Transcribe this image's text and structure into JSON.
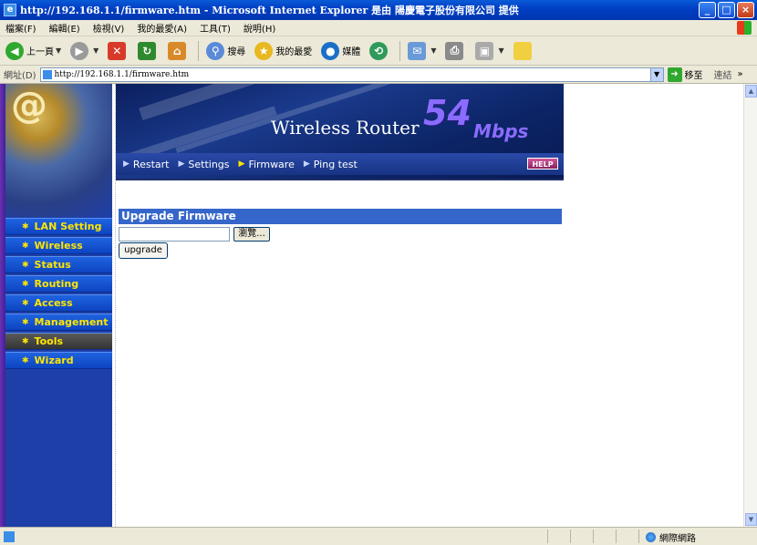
{
  "window": {
    "title": "http://192.168.1.1/firmware.htm - Microsoft Internet Explorer 是由 陽慶電子股份有限公司 提供",
    "controls": [
      "_",
      "□",
      "×"
    ]
  },
  "menubar": {
    "items": [
      "檔案(F)",
      "編輯(E)",
      "檢視(V)",
      "我的最愛(A)",
      "工具(T)",
      "說明(H)"
    ]
  },
  "toolbar": {
    "back_label": "上一頁",
    "search_label": "搜尋",
    "favorites_label": "我的最愛",
    "media_label": "媒體"
  },
  "addressbar": {
    "label": "網址(D)",
    "url": "http://192.168.1.1/firmware.htm",
    "go_label": "移至",
    "links_label": "連結"
  },
  "sidebar": {
    "nav": [
      {
        "label": "LAN Setting"
      },
      {
        "label": "Wireless"
      },
      {
        "label": "Status"
      },
      {
        "label": "Routing"
      },
      {
        "label": "Access"
      },
      {
        "label": "Management"
      },
      {
        "label": "Tools"
      },
      {
        "label": "Wizard"
      }
    ],
    "active_index": 6
  },
  "banner": {
    "brand": "Wireless Router",
    "speed": "54",
    "unit": "Mbps",
    "subnav": [
      "Restart",
      "Settings",
      "Firmware",
      "Ping test"
    ],
    "help_label": "HELP"
  },
  "main": {
    "section_title": "Upgrade Firmware",
    "file_value": "",
    "browse_label": "瀏覽...",
    "upgrade_label": "upgrade"
  },
  "statusbar": {
    "zone_label": "網際網路"
  },
  "colors": {
    "sidebar_bg": "#1e3fa8",
    "nav_text": "#ffe600",
    "section_header": "#3566c9",
    "banner_bg": "#0b1f5e"
  }
}
